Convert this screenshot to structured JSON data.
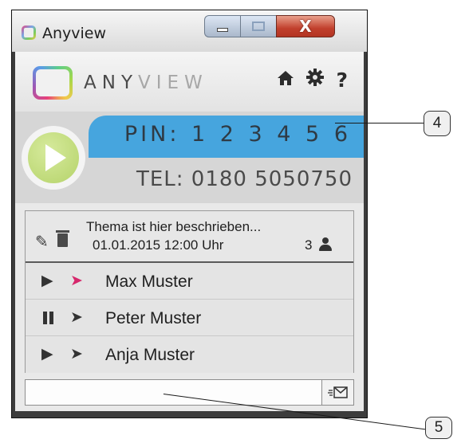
{
  "window": {
    "title": "Anyview",
    "controls": {
      "minimize": "minimize-icon",
      "maximize": "maximize-icon",
      "close_label": "X"
    }
  },
  "header": {
    "brand_any": "ANY",
    "brand_view": "VIEW",
    "icons": [
      "home-icon",
      "gear-icon",
      "help-icon"
    ],
    "help_glyph": "?"
  },
  "session": {
    "pin": "PIN: 1 2 3 4 5 6",
    "tel": "TEL: 0180 5050750",
    "pin_band_color": "#46a5de",
    "play_color": "#b5d36a"
  },
  "topic": {
    "title": "Thema ist hier beschrieben...",
    "datetime": "01.01.2015 12:00 Uhr",
    "participant_count": "3"
  },
  "participants": [
    {
      "name": "Max Muster",
      "state": "playing",
      "state_icon": "play-icon",
      "cursor_color": "#d6286c"
    },
    {
      "name": "Peter Muster",
      "state": "paused",
      "state_icon": "pause-icon",
      "cursor_color": "#333333"
    },
    {
      "name": "Anja Muster",
      "state": "playing",
      "state_icon": "play-icon",
      "cursor_color": "#333333"
    }
  ],
  "message": {
    "value": "",
    "placeholder": ""
  },
  "callouts": [
    "4",
    "5"
  ]
}
